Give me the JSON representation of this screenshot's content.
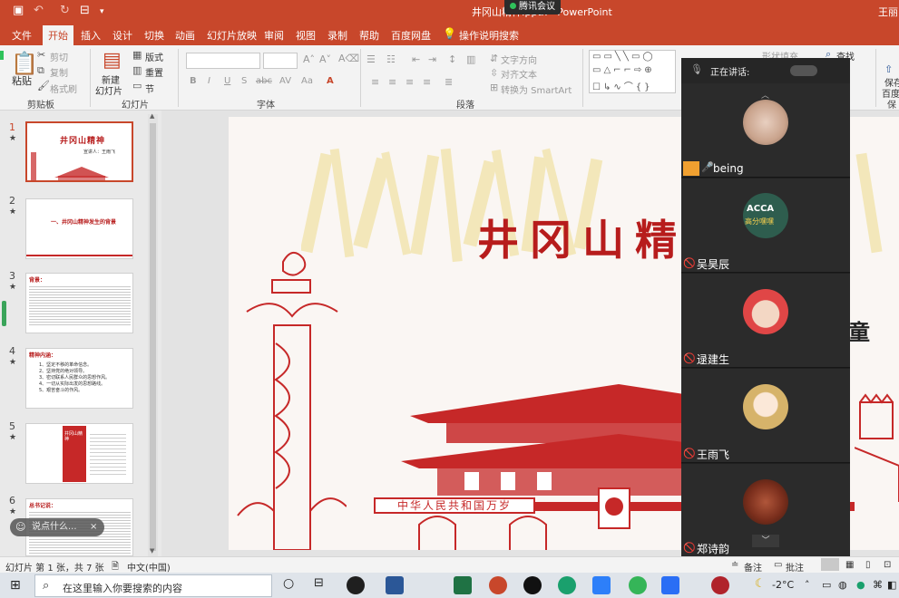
{
  "titlebar": {
    "title": "井冈山精神.pptx - PowerPoint",
    "meeting_badge": "腾讯会议",
    "user": "王丽"
  },
  "ribbon_tabs": [
    "文件",
    "开始",
    "插入",
    "设计",
    "切换",
    "动画",
    "幻灯片放映",
    "审阅",
    "视图",
    "录制",
    "帮助",
    "百度网盘",
    "操作说明搜索"
  ],
  "ribbon": {
    "clipboard": {
      "paste": "粘贴",
      "cut": "剪切",
      "copy": "复制",
      "format_painter": "格式刷",
      "group": "剪贴板"
    },
    "slides": {
      "new_slide": "新建",
      "new_slide2": "幻灯片",
      "layout": "版式",
      "reset": "重置",
      "section": "节",
      "group": "幻灯片"
    },
    "font": {
      "group": "字体",
      "bold": "B",
      "italic": "I",
      "underline": "U",
      "strike": "S",
      "shadow": "abc",
      "spacing": "AV",
      "case": "Aa",
      "font_color": "A"
    },
    "paragraph": {
      "group": "段落",
      "text_direction": "文字方向",
      "align_text": "对齐文本",
      "smartart": "转换为 SmartArt"
    },
    "drawing": {
      "shape_fill": "形状填充"
    },
    "editing": {
      "find": "查找"
    },
    "right_partial": {
      "save": "保存",
      "baidu": "百度",
      "group": "保"
    }
  },
  "slides_panel": [
    {
      "num": "1",
      "star": "★",
      "title": "井冈山精神",
      "subtitle": "宣讲人：王雨飞",
      "selected": true
    },
    {
      "num": "2",
      "star": "★",
      "title": "一、井冈山精神发生的背景",
      "selected": false
    },
    {
      "num": "3",
      "star": "★",
      "title": "背景：",
      "selected": false
    },
    {
      "num": "4",
      "star": "★",
      "title": "精神内涵：",
      "items": [
        "1、坚定不移的革命信念。",
        "2、坚持党的绝对领导。",
        "3、密切联系人民群众的思想作风。",
        "4、一切从实际出发的思想路线。",
        "5、艰苦奋斗的作风。"
      ],
      "selected": false
    },
    {
      "num": "5",
      "star": "★",
      "title": "井冈山精神",
      "selected": false
    },
    {
      "num": "6",
      "star": "★",
      "title": "总书记说：",
      "selected": false
    }
  ],
  "slide": {
    "title": "井冈山精",
    "title_right": "童",
    "banner": "中华人民共和国万岁"
  },
  "meeting": {
    "speaking_label": "正在讲话:",
    "participants": [
      {
        "name": "being",
        "mic": "on",
        "host": true
      },
      {
        "name": "吴昊辰",
        "avatar_text": "ACCA",
        "avatar_text2": "高分嘿嘿",
        "mic": "muted"
      },
      {
        "name": "逯建生",
        "mic": "muted"
      },
      {
        "name": "王雨飞",
        "mic": "muted"
      },
      {
        "name": "郑诗韵",
        "mic": "muted"
      }
    ],
    "colors": {
      "panel": "#1f1f1f",
      "tile": "#2b2b2b",
      "host_tag": "#f0a030"
    }
  },
  "comment_bubble": "说点什么...",
  "statusbar": {
    "slide_info": "幻灯片 第 1 张，共 7 张",
    "language": "中文(中国)",
    "notes": "备注",
    "comments": "批注"
  },
  "taskbar": {
    "search_placeholder": "在这里输入你要搜索的内容",
    "weather": "-2°C",
    "colors": {
      "accent": "#c8472b"
    }
  },
  "colors": {
    "ppt_red": "#c8472b",
    "slide_red": "#b71c1c",
    "ribbon_bg": "#f3f3f3"
  }
}
